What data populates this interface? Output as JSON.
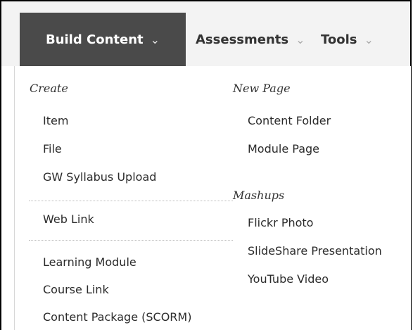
{
  "tabs": {
    "build": "Build Content",
    "assessments": "Assessments",
    "tools": "Tools"
  },
  "chevron": "chevron-down-icon",
  "menu": {
    "create": {
      "heading": "Create",
      "items": [
        "Item",
        "File",
        "GW Syllabus Upload",
        "Web Link",
        "Learning Module",
        "Course Link",
        "Content Package (SCORM)"
      ]
    },
    "new_page": {
      "heading": "New Page",
      "items": [
        "Content Folder",
        "Module Page"
      ]
    },
    "mashups": {
      "heading": "Mashups",
      "items": [
        "Flickr Photo",
        "SlideShare Presentation",
        "YouTube Video"
      ]
    }
  }
}
